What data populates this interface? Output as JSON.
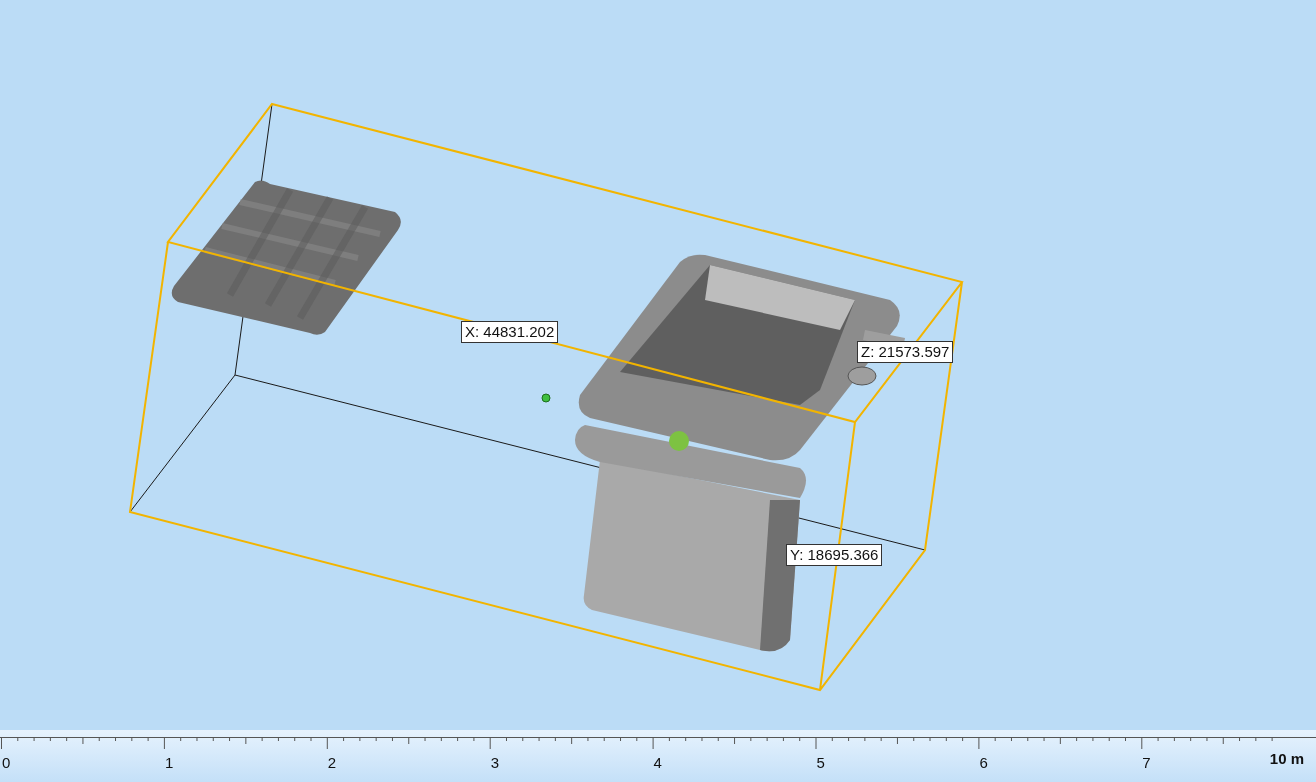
{
  "viewport": {
    "dimension_labels": [
      "X: 44831.202",
      "Z: 21573.597",
      "Y: 18695.366"
    ]
  },
  "scale_bar": {
    "labels": [
      "0",
      "1",
      "2",
      "3",
      "4",
      "5",
      "6",
      "7"
    ],
    "unit_label": "10 m"
  }
}
